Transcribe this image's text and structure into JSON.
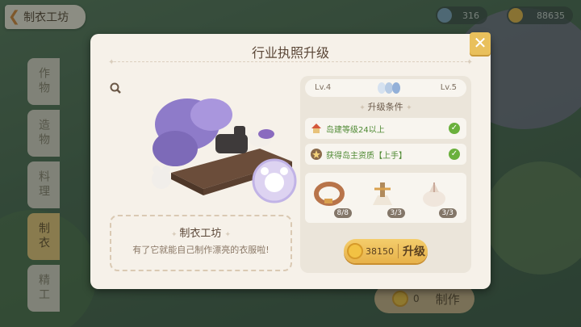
{
  "header": {
    "back_title": "制衣工坊",
    "currency1_value": "316",
    "currency2_value": "88635"
  },
  "side_tabs": [
    "作物",
    "造物",
    "料理",
    "制衣",
    "精工"
  ],
  "make_button": {
    "count": "0",
    "label": "制作"
  },
  "modal": {
    "title": "行业执照升级",
    "close_label": "✕",
    "item_name": "制衣工坊",
    "item_desc": "有了它就能自己制作漂亮的衣服啦!",
    "level_from": "Lv.4",
    "level_to": "Lv.5",
    "conditions_title": "升级条件",
    "conditions": [
      {
        "text": "岛建等级24以上",
        "met": true
      },
      {
        "text": "获得岛主资质【上手】",
        "met": true
      }
    ],
    "materials": [
      {
        "name": "belt",
        "count": "8/8"
      },
      {
        "name": "thread-spool",
        "count": "3/3"
      },
      {
        "name": "cloth-bag",
        "count": "3/3"
      }
    ],
    "upgrade_cost": "38150",
    "upgrade_label": "升级"
  },
  "colors": {
    "accent": "#e9c05c",
    "check": "#6ab03c",
    "condition_text": "#4f8a34"
  }
}
